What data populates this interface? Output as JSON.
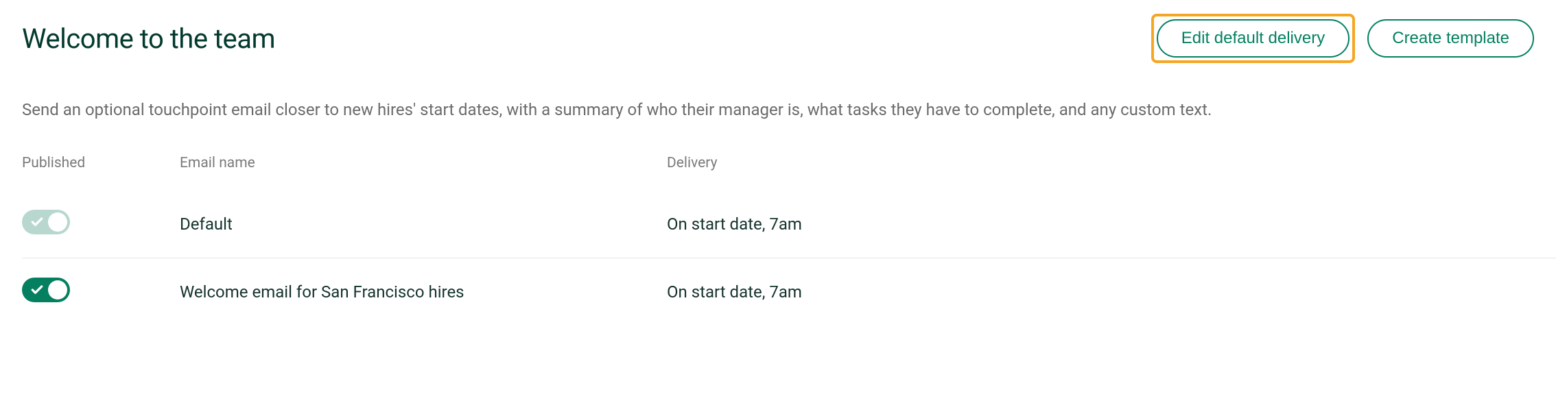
{
  "header": {
    "title": "Welcome to the team",
    "edit_default_delivery_label": "Edit default delivery",
    "create_template_label": "Create template"
  },
  "description": "Send an optional touchpoint email closer to new hires' start dates, with a summary of who their manager is, what tasks they have to complete, and any custom text.",
  "columns": {
    "published": "Published",
    "email_name": "Email name",
    "delivery": "Delivery"
  },
  "rows": [
    {
      "published": false,
      "name": "Default",
      "delivery": "On start date, 7am"
    },
    {
      "published": true,
      "name": "Welcome email for San Francisco hires",
      "delivery": "On start date, 7am"
    }
  ]
}
